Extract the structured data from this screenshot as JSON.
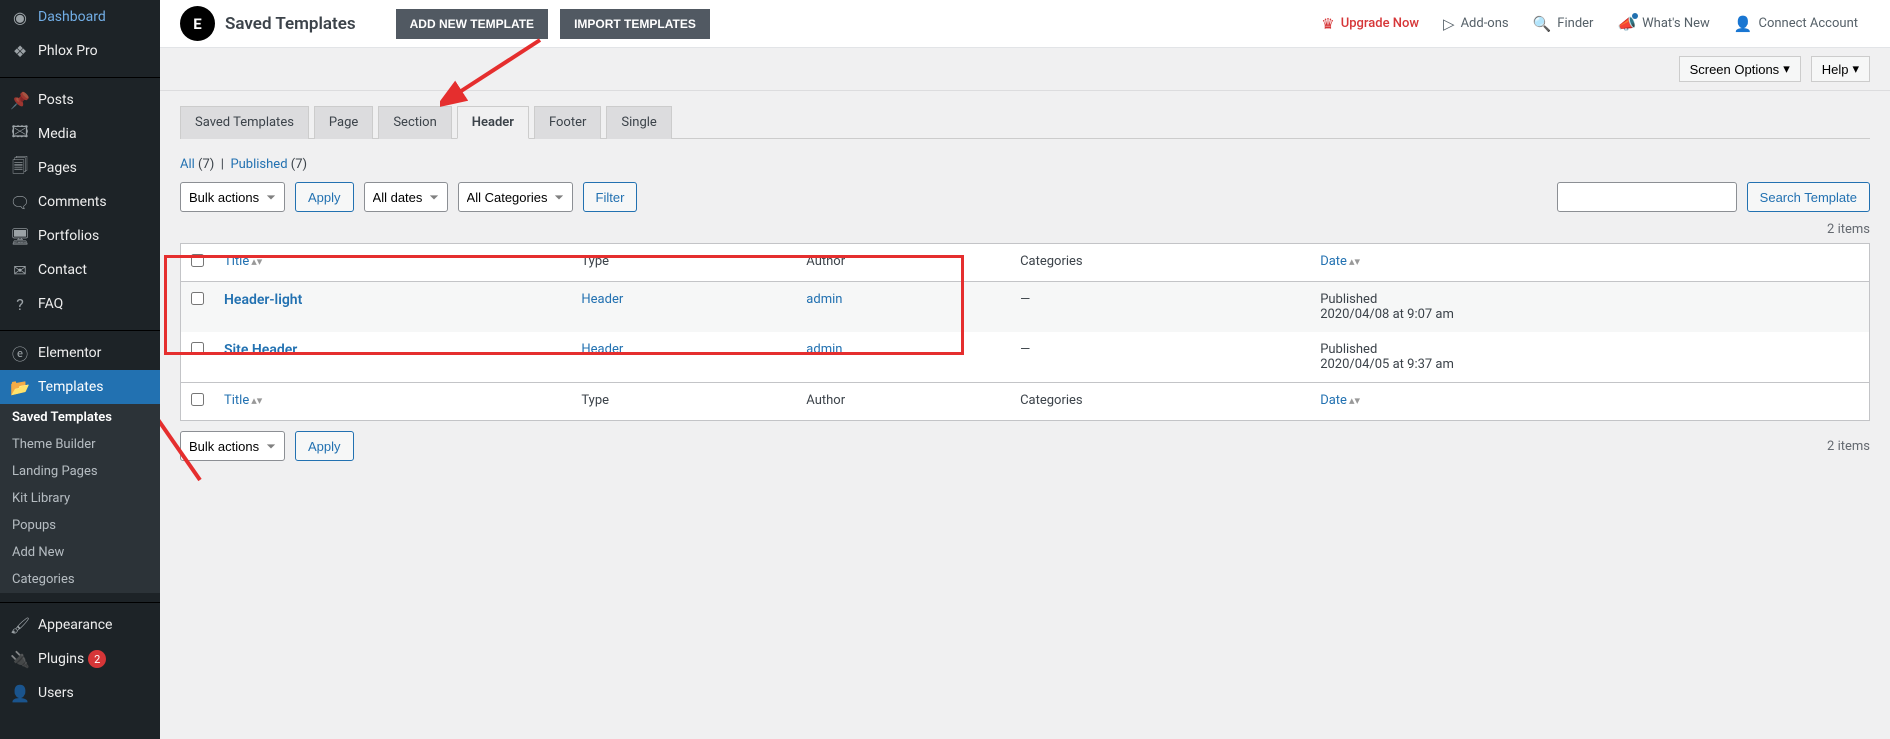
{
  "sidebar": {
    "items": [
      {
        "label": "Dashboard",
        "icon": "🏠"
      },
      {
        "label": "Phlox Pro",
        "icon": "⚙"
      },
      {
        "label": "Posts",
        "icon": "📌"
      },
      {
        "label": "Media",
        "icon": "🖼"
      },
      {
        "label": "Pages",
        "icon": "📄"
      },
      {
        "label": "Comments",
        "icon": "💬"
      },
      {
        "label": "Portfolios",
        "icon": "🖥"
      },
      {
        "label": "Contact",
        "icon": "✉"
      },
      {
        "label": "FAQ",
        "icon": "❓"
      },
      {
        "label": "Elementor",
        "icon": "ⓔ"
      },
      {
        "label": "Templates",
        "icon": "📁",
        "active": true
      },
      {
        "label": "Appearance",
        "icon": "🖌"
      },
      {
        "label": "Plugins",
        "icon": "🔌",
        "badge": "2"
      },
      {
        "label": "Users",
        "icon": "👤"
      }
    ],
    "submenu": [
      {
        "label": "Saved Templates",
        "current": true
      },
      {
        "label": "Theme Builder"
      },
      {
        "label": "Landing Pages"
      },
      {
        "label": "Kit Library"
      },
      {
        "label": "Popups"
      },
      {
        "label": "Add New"
      },
      {
        "label": "Categories"
      }
    ]
  },
  "topbar": {
    "title": "Saved Templates",
    "add_btn": "ADD NEW TEMPLATE",
    "import_btn": "IMPORT TEMPLATES",
    "upgrade": "Upgrade Now",
    "addons": "Add-ons",
    "finder": "Finder",
    "whatsnew": "What's New",
    "connect": "Connect Account"
  },
  "secondary": {
    "screen": "Screen Options",
    "help": "Help"
  },
  "tabs": [
    "Saved Templates",
    "Page",
    "Section",
    "Header",
    "Footer",
    "Single"
  ],
  "active_tab": 3,
  "filters": {
    "all": "All",
    "all_count": "(7)",
    "sep": "|",
    "pub": "Published",
    "pub_count": "(7)"
  },
  "actions": {
    "bulk": "Bulk actions",
    "apply": "Apply",
    "all_dates": "All dates",
    "all_cat": "All Categories",
    "filter": "Filter",
    "search_btn": "Search Template",
    "items": "2 items"
  },
  "table": {
    "cols": {
      "title": "Title",
      "type": "Type",
      "author": "Author",
      "cat": "Categories",
      "date": "Date"
    },
    "rows": [
      {
        "title": "Header-light",
        "type": "Header",
        "author": "admin",
        "cat": "—",
        "date_status": "Published",
        "date": "2020/04/08 at 9:07 am"
      },
      {
        "title": "Site Header",
        "type": "Header",
        "author": "admin",
        "cat": "—",
        "date_status": "Published",
        "date": "2020/04/05 at 9:37 am"
      }
    ]
  }
}
